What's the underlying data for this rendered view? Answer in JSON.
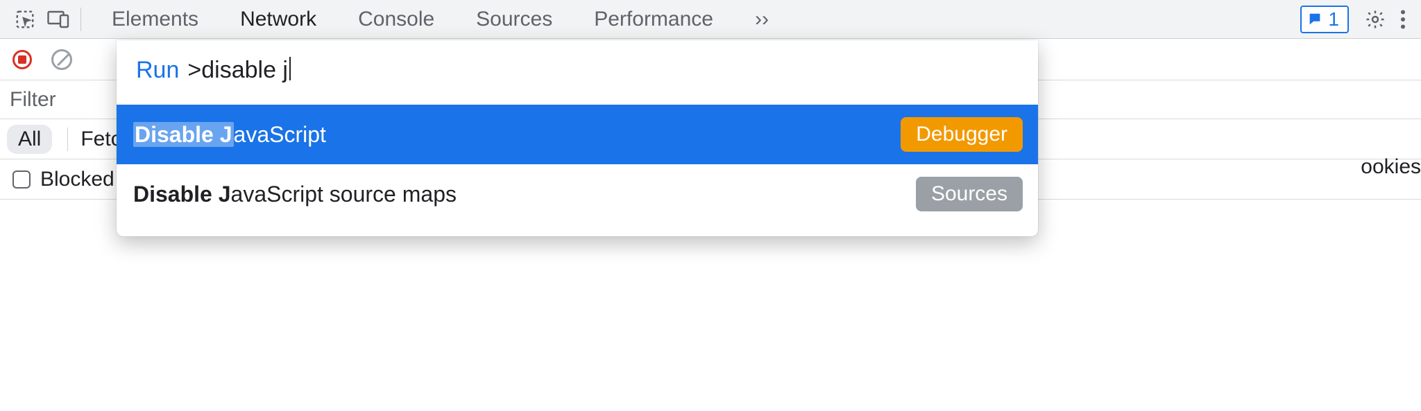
{
  "tabs": {
    "items": [
      "Elements",
      "Network",
      "Console",
      "Sources",
      "Performance"
    ],
    "active_index": 1,
    "overflow_glyph": "››"
  },
  "issues_chip": {
    "count": "1"
  },
  "filter": {
    "label": "Filter"
  },
  "types": {
    "all": "All",
    "second": "Fetch",
    "trailing": "ookies"
  },
  "blocked": {
    "label": "Blocked"
  },
  "palette": {
    "run_label": "Run",
    "prefix": ">",
    "typed": "disable j",
    "results": [
      {
        "bold": "Disable J",
        "rest": "avaScript",
        "badge": "Debugger",
        "badge_color": "orange",
        "selected": true,
        "highlight_bold": true
      },
      {
        "bold": "Disable J",
        "rest": "avaScript source maps",
        "badge": "Sources",
        "badge_color": "grey",
        "selected": false,
        "highlight_bold": false
      }
    ]
  }
}
